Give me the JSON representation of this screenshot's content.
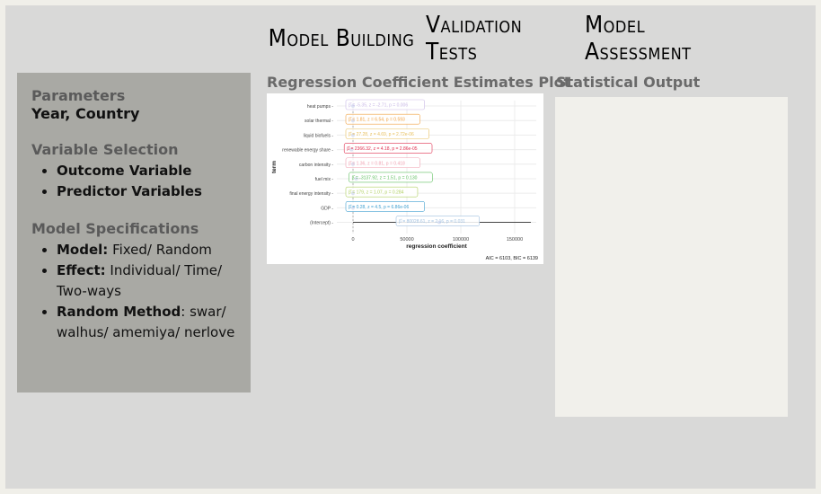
{
  "tabs": [
    {
      "label": "Model Building",
      "active": true
    },
    {
      "label": "Validation Tests",
      "active": false
    },
    {
      "label": "Model Assessment",
      "active": false
    }
  ],
  "sidebar": {
    "parameters": {
      "heading": "Parameters",
      "value": "Year, Country"
    },
    "variable_selection": {
      "heading": "Variable Selection",
      "items": [
        "Outcome Variable",
        "Predictor Variables"
      ]
    },
    "model_specs": {
      "heading": "Model Specifications",
      "items": [
        {
          "label": "Model:",
          "value": " Fixed/ Random"
        },
        {
          "label": "Effect:",
          "value": " Individual/ Time/ Two-ways"
        },
        {
          "label": "Random Method",
          "value": ": swar/ walhus/ amemiya/ nerlove"
        }
      ]
    }
  },
  "plot": {
    "title": "Regression Coefficient Estimates Plot",
    "chart_data": {
      "type": "scatter",
      "ylabel": "term",
      "xlabel": "regression coefficient",
      "x_ticks": [
        0,
        50000,
        100000,
        150000
      ],
      "x_tick_labels": [
        "0",
        "50000",
        "100000",
        "150000"
      ],
      "xlim": [
        -15000,
        170000
      ],
      "footer": "AIC = 6103, BIC = 6139",
      "terms": [
        {
          "name": "heat pumps",
          "estimate": 0,
          "ci": [
            -300,
            300
          ],
          "label": "β̂ = -5.35, z = -2.71, p = 0.006",
          "color": "#c9b8e6"
        },
        {
          "name": "solar thermal",
          "estimate": 0,
          "ci": [
            -300,
            300
          ],
          "label": "β̂ = 1.81, z = 6.54, p = 0.593",
          "color": "#f0a040"
        },
        {
          "name": "liquid biofuels",
          "estimate": 0,
          "ci": [
            -300,
            300
          ],
          "label": "β̂ = 27.28, z = 4.69, p = 2.72e-06",
          "color": "#e8c060"
        },
        {
          "name": "renewable energy share",
          "estimate": -1500,
          "ci": [
            -4000,
            1000
          ],
          "label": "β̂ = 2366.32, z = 4.18, p = 2.86e-05",
          "color": "#e03050"
        },
        {
          "name": "carbon intensity",
          "estimate": 0,
          "ci": [
            -300,
            300
          ],
          "label": "β̂ = 1.36, z = 0.81, p = 0.418",
          "color": "#f0a0b0"
        },
        {
          "name": "fuel mix",
          "estimate": 3000,
          "ci": [
            -1000,
            7000
          ],
          "label": "β̂ = -3137.92, z = 1.51, p = 0.130",
          "color": "#60c060"
        },
        {
          "name": "final energy intensity",
          "estimate": 0,
          "ci": [
            -300,
            300
          ],
          "label": "β̂ = 179, z = 1.07, p = 0.284",
          "color": "#b0d060"
        },
        {
          "name": "GDP",
          "estimate": 0,
          "ci": [
            -300,
            300
          ],
          "label": "β̂ = 0.28, z = 4.5, p = 6.86e-06",
          "color": "#40a0d0"
        },
        {
          "name": "(Intercept)",
          "estimate": 80000,
          "ci": [
            0,
            165000
          ],
          "label": "β̂ = 80028.61, z = 2.16, p = 0.031",
          "color": "#a0c0e0"
        }
      ]
    }
  },
  "output": {
    "title": "Statistical Output"
  }
}
